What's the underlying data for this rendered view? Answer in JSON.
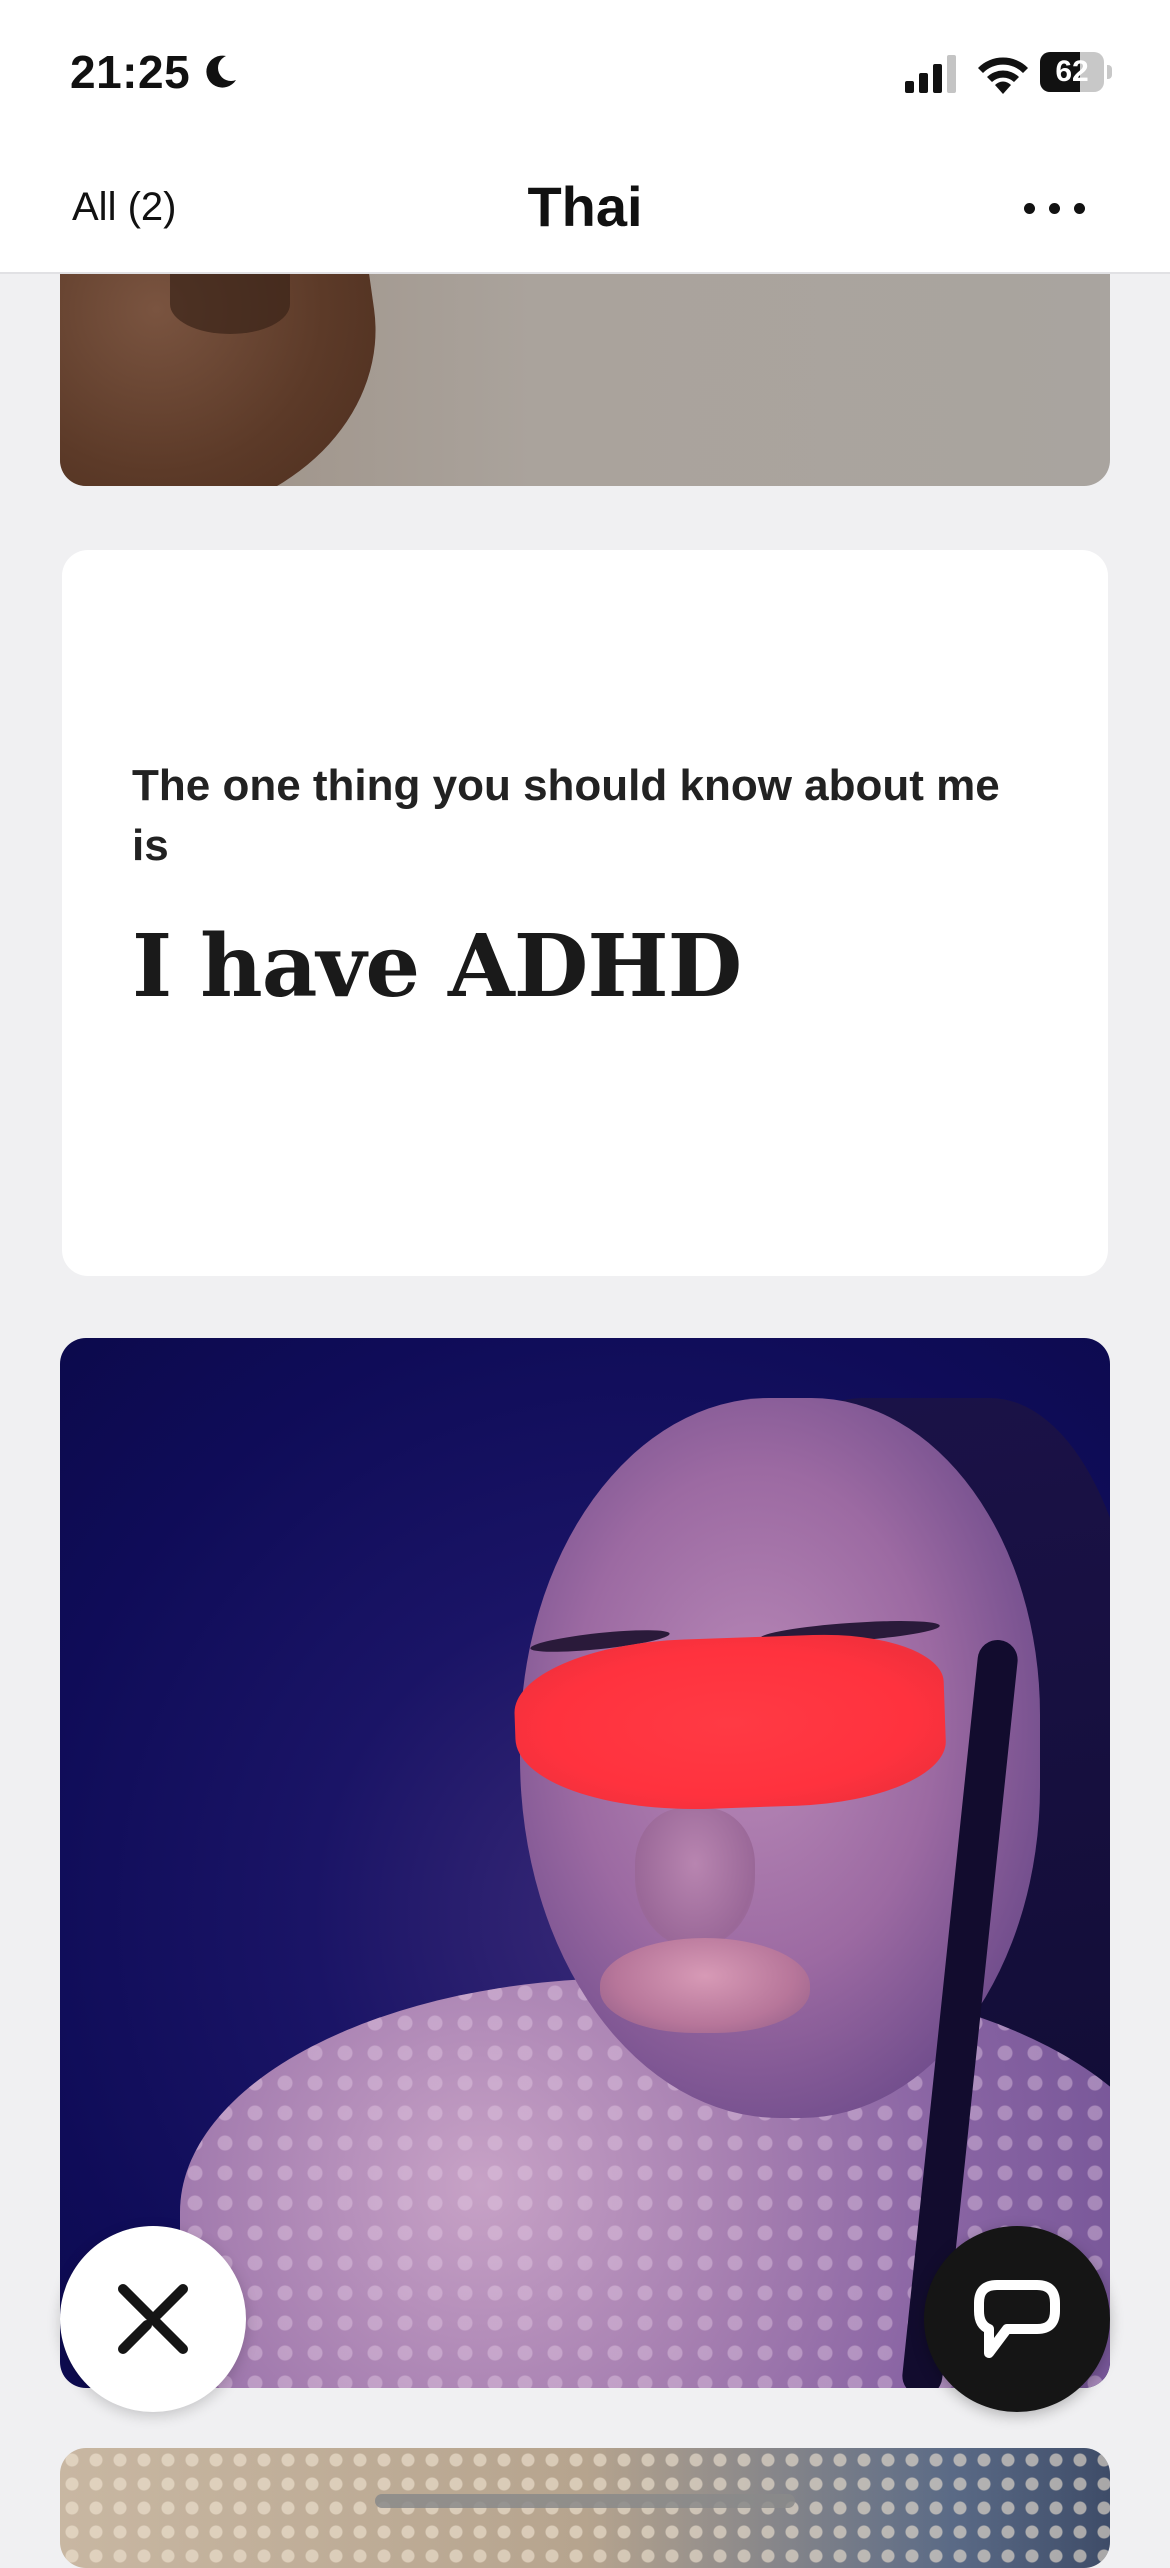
{
  "status_bar": {
    "time": "21:25",
    "focus_icon": "moon-icon",
    "signal_icon": "cellular-signal-icon",
    "wifi_icon": "wifi-icon",
    "battery_level": "62",
    "battery_percent": 62
  },
  "header": {
    "back_label": "All (2)",
    "title": "Thai",
    "more_icon": "ellipsis-icon"
  },
  "prompt": {
    "question": "The one thing you should know about me is",
    "answer": "I have ADHD"
  },
  "actions": {
    "skip_icon": "close-x-icon",
    "chat_icon": "chat-bubble-icon"
  },
  "colors": {
    "background": "#f0f0f2",
    "card": "#ffffff",
    "text": "#111111",
    "chat_button": "#151515",
    "redaction": "#ff323e"
  }
}
